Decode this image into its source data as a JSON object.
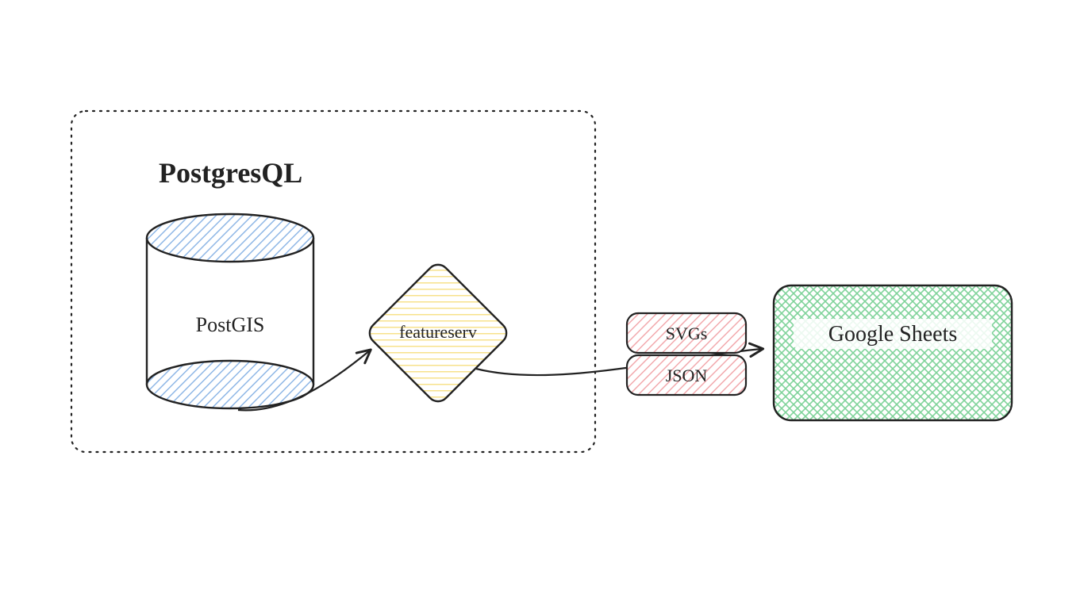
{
  "group": {
    "title": "PostgresQL"
  },
  "nodes": {
    "database": {
      "label": "PostGIS"
    },
    "service": {
      "label": "featureserv"
    },
    "output_top": {
      "label": "SVGs"
    },
    "output_bottom": {
      "label": "JSON"
    },
    "destination": {
      "label": "Google Sheets"
    }
  },
  "colors": {
    "db_fill": "#8fb7e6",
    "service_fill": "#f7e28b",
    "output_fill": "#f2a9ad",
    "dest_fill": "#7fd39a",
    "stroke": "#222222"
  }
}
